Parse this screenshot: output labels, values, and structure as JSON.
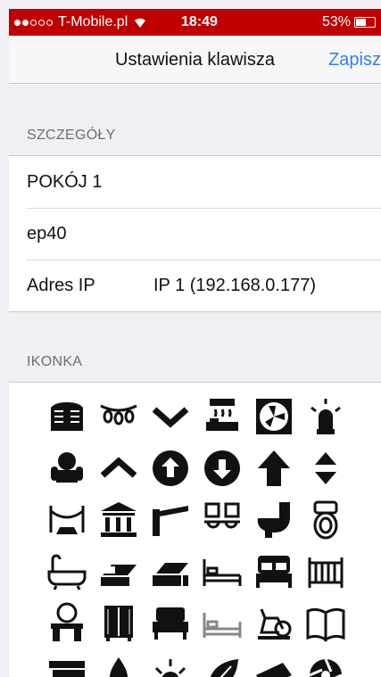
{
  "status": {
    "carrier": "T-Mobile.pl",
    "time": "18:49",
    "battery_text": "53%",
    "battery_level": 0.53,
    "signal_bars_filled": 2
  },
  "nav": {
    "title": "Ustawienia klawisza",
    "save_label": "Zapisz"
  },
  "details": {
    "header": "SZCZEGÓŁY",
    "room": "POKÓJ 1",
    "device": "ep40",
    "ip_label": "Adres IP",
    "ip_value": "IP 1 (192.168.0.177)"
  },
  "icons": {
    "header": "IKONKA",
    "items": [
      "saloon-doors-icon",
      "string-lights-icon",
      "chevron-down-icon",
      "air-conditioner-bed-icon",
      "exhaust-fan-icon",
      "siren-icon",
      "armchair-icon",
      "chevron-up-icon",
      "circle-arrow-up-icon",
      "circle-arrow-down-icon",
      "arrow-up-icon",
      "sort-up-down-icon",
      "stanchion-barrier-icon",
      "bank-icon",
      "parking-barrier-icon",
      "double-sink-icon",
      "toilet-side-icon",
      "toilet-top-icon",
      "bathtub-icon",
      "bed-pillows-icon",
      "bed-pillows-alt-icon",
      "bed-outline-icon",
      "double-bed-icon",
      "crib-icon",
      "vanity-table-icon",
      "wardrobe-icon",
      "bed-front-icon",
      "bed-frame-icon",
      "exercise-bike-icon",
      "open-book-icon",
      "books-stack-icon",
      "water-drop-icon",
      "sun-icon",
      "leaf-icon",
      "stage-light-icon",
      "camera-aperture-icon"
    ]
  }
}
